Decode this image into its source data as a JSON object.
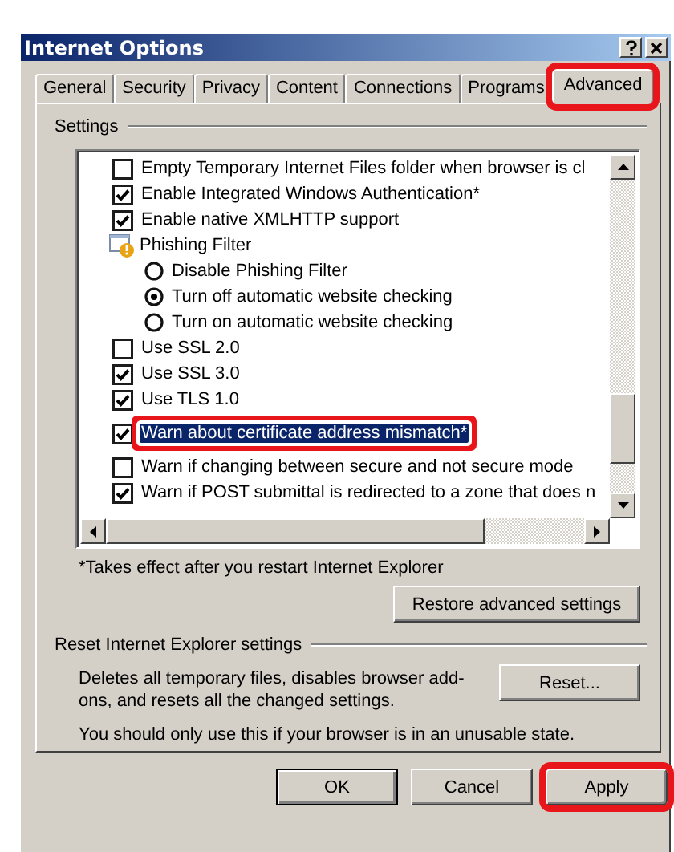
{
  "window": {
    "title": "Internet Options"
  },
  "tabs": [
    {
      "label": "General",
      "selected": false,
      "highlighted": false
    },
    {
      "label": "Security",
      "selected": false,
      "highlighted": false
    },
    {
      "label": "Privacy",
      "selected": false,
      "highlighted": false
    },
    {
      "label": "Content",
      "selected": false,
      "highlighted": false
    },
    {
      "label": "Connections",
      "selected": false,
      "highlighted": false
    },
    {
      "label": "Programs",
      "selected": false,
      "highlighted": false
    },
    {
      "label": "Advanced",
      "selected": true,
      "highlighted": true
    }
  ],
  "settings": {
    "title": "Settings",
    "items": [
      {
        "kind": "checkbox",
        "label": "Empty Temporary Internet Files folder when browser is cl",
        "checked": false,
        "selected": false,
        "highlighted": false
      },
      {
        "kind": "checkbox",
        "label": "Enable Integrated Windows Authentication*",
        "checked": true,
        "selected": false,
        "highlighted": false
      },
      {
        "kind": "checkbox",
        "label": "Enable native XMLHTTP support",
        "checked": true,
        "selected": false,
        "highlighted": false
      },
      {
        "kind": "group",
        "label": "Phishing Filter",
        "children": [
          {
            "kind": "radio",
            "label": "Disable Phishing Filter",
            "checked": false,
            "selected": false,
            "highlighted": false
          },
          {
            "kind": "radio",
            "label": "Turn off automatic website checking",
            "checked": true,
            "selected": false,
            "highlighted": false
          },
          {
            "kind": "radio",
            "label": "Turn on automatic website checking",
            "checked": false,
            "selected": false,
            "highlighted": false
          }
        ]
      },
      {
        "kind": "checkbox",
        "label": "Use SSL 2.0",
        "checked": false,
        "selected": false,
        "highlighted": false
      },
      {
        "kind": "checkbox",
        "label": "Use SSL 3.0",
        "checked": true,
        "selected": false,
        "highlighted": false
      },
      {
        "kind": "checkbox",
        "label": "Use TLS 1.0",
        "checked": true,
        "selected": false,
        "highlighted": false
      },
      {
        "kind": "checkbox",
        "label": "Warn about certificate address mismatch*",
        "checked": true,
        "selected": true,
        "highlighted": true
      },
      {
        "kind": "checkbox",
        "label": "Warn if changing between secure and not secure mode",
        "checked": false,
        "selected": false,
        "highlighted": false
      },
      {
        "kind": "checkbox",
        "label": "Warn if POST submittal is redirected to a zone that does n",
        "checked": true,
        "selected": false,
        "highlighted": false
      }
    ],
    "note": "*Takes effect after you restart Internet Explorer",
    "restore_button": "Restore advanced settings"
  },
  "reset": {
    "title": "Reset Internet Explorer settings",
    "description": "Deletes all temporary files, disables browser add-ons, and resets all the changed settings.",
    "button": "Reset...",
    "warning": "You should only use this if your browser is in an unusable state."
  },
  "buttons": [
    {
      "label": "OK",
      "highlighted": false
    },
    {
      "label": "Cancel",
      "highlighted": false
    },
    {
      "label": "Apply",
      "highlighted": true
    }
  ]
}
